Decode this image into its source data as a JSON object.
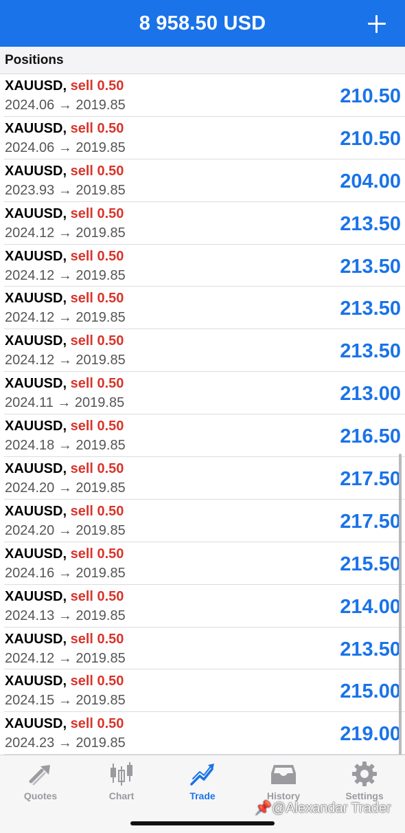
{
  "header": {
    "balance": "8 958.50 USD"
  },
  "section": {
    "title": "Positions"
  },
  "positions": [
    {
      "symbol": "XAUUSD,",
      "side": "sell 0.50",
      "prices": "2024.06 → 2019.85",
      "profit": "210.50"
    },
    {
      "symbol": "XAUUSD,",
      "side": "sell 0.50",
      "prices": "2024.06 → 2019.85",
      "profit": "210.50"
    },
    {
      "symbol": "XAUUSD,",
      "side": "sell 0.50",
      "prices": "2023.93 → 2019.85",
      "profit": "204.00"
    },
    {
      "symbol": "XAUUSD,",
      "side": "sell 0.50",
      "prices": "2024.12 → 2019.85",
      "profit": "213.50"
    },
    {
      "symbol": "XAUUSD,",
      "side": "sell 0.50",
      "prices": "2024.12 → 2019.85",
      "profit": "213.50"
    },
    {
      "symbol": "XAUUSD,",
      "side": "sell 0.50",
      "prices": "2024.12 → 2019.85",
      "profit": "213.50"
    },
    {
      "symbol": "XAUUSD,",
      "side": "sell 0.50",
      "prices": "2024.12 → 2019.85",
      "profit": "213.50"
    },
    {
      "symbol": "XAUUSD,",
      "side": "sell 0.50",
      "prices": "2024.11 → 2019.85",
      "profit": "213.00"
    },
    {
      "symbol": "XAUUSD,",
      "side": "sell 0.50",
      "prices": "2024.18 → 2019.85",
      "profit": "216.50"
    },
    {
      "symbol": "XAUUSD,",
      "side": "sell 0.50",
      "prices": "2024.20 → 2019.85",
      "profit": "217.50"
    },
    {
      "symbol": "XAUUSD,",
      "side": "sell 0.50",
      "prices": "2024.20 → 2019.85",
      "profit": "217.50"
    },
    {
      "symbol": "XAUUSD,",
      "side": "sell 0.50",
      "prices": "2024.16 → 2019.85",
      "profit": "215.50"
    },
    {
      "symbol": "XAUUSD,",
      "side": "sell 0.50",
      "prices": "2024.13 → 2019.85",
      "profit": "214.00"
    },
    {
      "symbol": "XAUUSD,",
      "side": "sell 0.50",
      "prices": "2024.12 → 2019.85",
      "profit": "213.50"
    },
    {
      "symbol": "XAUUSD,",
      "side": "sell 0.50",
      "prices": "2024.15 → 2019.85",
      "profit": "215.00"
    },
    {
      "symbol": "XAUUSD,",
      "side": "sell 0.50",
      "prices": "2024.23 → 2019.85",
      "profit": "219.00"
    }
  ],
  "tabs": [
    {
      "label": "Quotes",
      "icon": "quotes-icon",
      "active": false
    },
    {
      "label": "Chart",
      "icon": "candlestick-chart-icon",
      "active": false
    },
    {
      "label": "Trade",
      "icon": "trade-icon",
      "active": true
    },
    {
      "label": "History",
      "icon": "history-icon",
      "active": false
    },
    {
      "label": "Settings",
      "icon": "gear-icon",
      "active": false
    }
  ],
  "watermark": "📌@Alexandar Trader",
  "colors": {
    "accent": "#1a73e8",
    "sell": "#d9342b",
    "inactive": "#9a9a9f"
  }
}
